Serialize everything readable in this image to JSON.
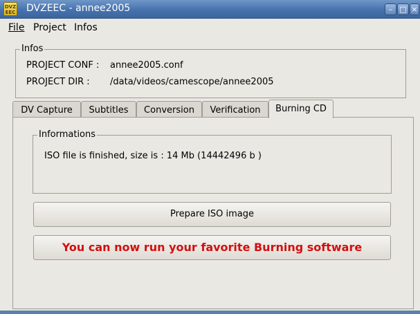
{
  "window": {
    "title": "DVZEEC - annee2005",
    "icon_text": "DVZ EEC",
    "controls": {
      "minimize": "–",
      "maximize": "□",
      "close": "×"
    }
  },
  "menu": {
    "file": "File",
    "project": "Project",
    "infos": "Infos"
  },
  "infos": {
    "label": "Infos",
    "conf_label": "PROJECT CONF :",
    "conf_value": "annee2005.conf",
    "dir_label": "PROJECT DIR :",
    "dir_value": "/data/videos/camescope/annee2005"
  },
  "tabs": [
    "DV Capture",
    "Subtitles",
    "Conversion",
    "Verification",
    "Burning CD"
  ],
  "active_tab": "Burning CD",
  "burning": {
    "informations_label": "Informations",
    "message": "ISO file is finished, size is : 14 Mb (14442496 b )",
    "prepare_button": "Prepare ISO image",
    "run_message": "You can now run your favorite Burning software"
  },
  "colors": {
    "titlebar": "#4672ad",
    "alert_text": "#d40f0f",
    "background": "#eae8e3"
  }
}
